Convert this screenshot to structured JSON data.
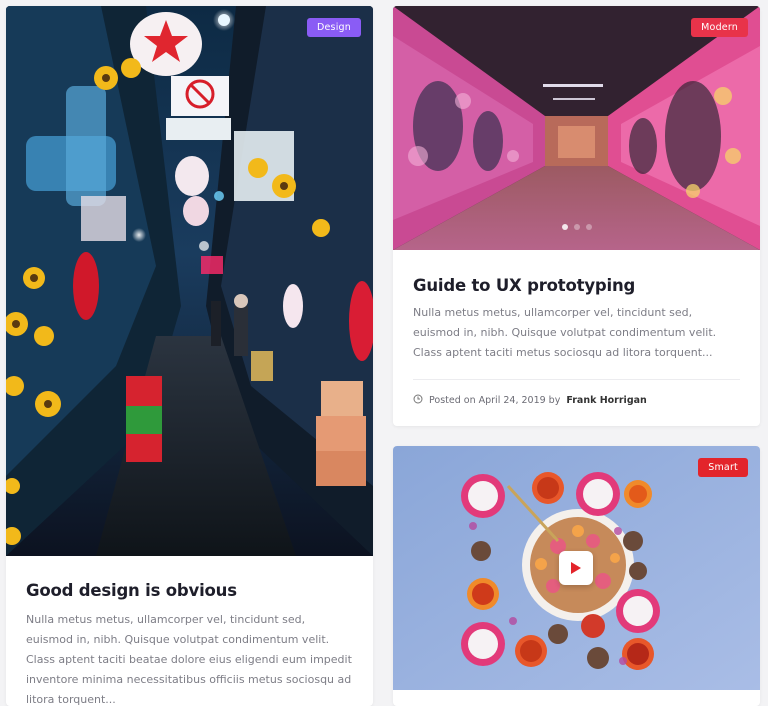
{
  "cards": [
    {
      "badge": "Design",
      "badge_color": "#8a5cf5",
      "title": "Good design is obvious",
      "excerpt": "Nulla metus metus, ullamcorper vel, tincidunt sed, euismod in, nibh. Quisque volutpat condimentum velit. Class aptent taciti beatae dolore eius eligendi eum impedit inventore minima necessitatibus officiis metus sociosqu ad litora torquent...",
      "image": "neon-alley-photo"
    },
    {
      "badge": "Modern",
      "badge_color": "#e8334a",
      "title": "Guide to UX prototyping",
      "excerpt": "Nulla metus metus, ullamcorper vel, tincidunt sed, euismod in, nibh. Quisque volutpat condimentum velit. Class aptent taciti metus sociosqu ad litora torquent...",
      "meta_prefix": "Posted on April 24, 2019 by",
      "author": "Frank Horrigan",
      "image": "graffiti-tunnel-photo",
      "slider_dots": 3,
      "active_dot": 0
    },
    {
      "badge": "Smart",
      "badge_color": "#e3242b",
      "image": "fruit-bowl-photo",
      "has_video": true
    }
  ]
}
